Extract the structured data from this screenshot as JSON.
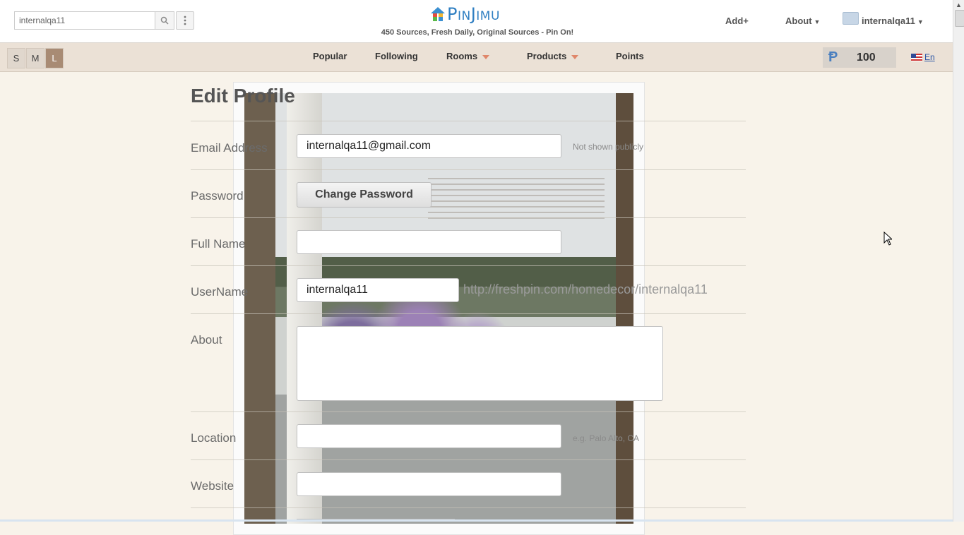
{
  "header": {
    "search": {
      "value": "internalqa11"
    },
    "logo_text": "PinJimu",
    "tagline": "450 Sources, Fresh Daily, Original Sources - Pin On!",
    "add_label": "Add+",
    "about_label": "About",
    "username": "internalqa11"
  },
  "subnav": {
    "sizes": [
      "S",
      "M",
      "L"
    ],
    "active_size": "L",
    "items": [
      "Popular",
      "Following",
      "Rooms",
      "Products",
      "Points"
    ],
    "points_value": "100",
    "language": "En"
  },
  "form": {
    "title": "Edit Profile",
    "email_label": "Email Address",
    "email_value": "internalqa11@gmail.com",
    "email_hint": "Not shown publicly",
    "password_label": "Password",
    "change_password_label": "Change Password",
    "fullname_label": "Full Name",
    "fullname_value": "",
    "username_label": "UserName",
    "username_value": "internalqa11",
    "username_url": "http://freshpin.com/homedecor/internalqa11",
    "about_label": "About",
    "about_value": "",
    "location_label": "Location",
    "location_value": "",
    "location_hint": "e.g. Palo Alto, CA",
    "website_label": "Website",
    "website_value": ""
  },
  "colors": {
    "background": "#f8f3ea",
    "logo_blue": "#2f7fc2",
    "active_size": "#a88b74",
    "menu_triangle": "#e0876a"
  }
}
